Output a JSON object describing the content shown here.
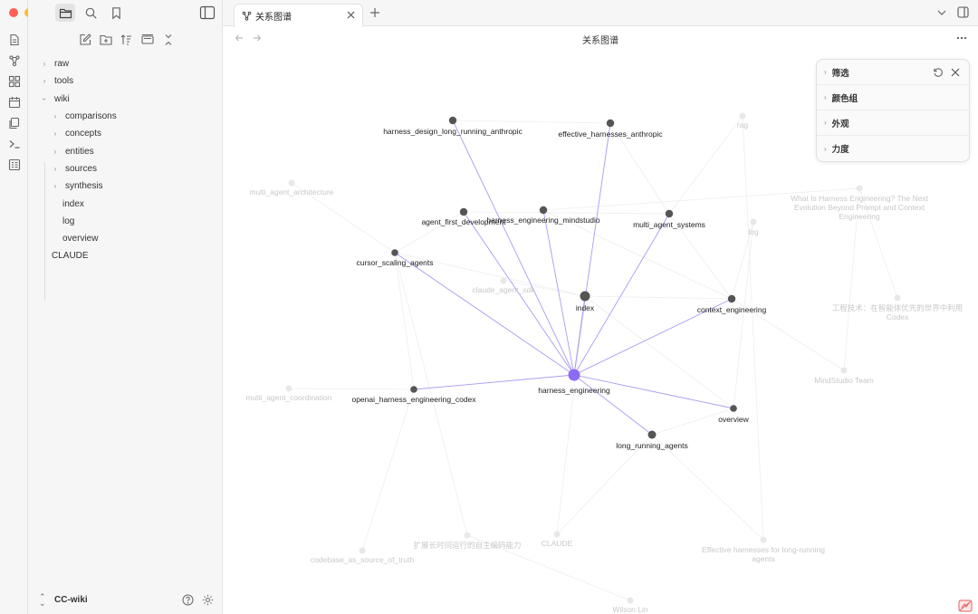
{
  "colors": {
    "sidebar_bg": "#f6f6f6",
    "accent_node": "#8b6cf0",
    "node": "#555555",
    "edge_highlight": "#a89cf0",
    "edge_faded": "#eeeeee",
    "traffic_red": "#ff5f57",
    "traffic_yellow": "#febc2e",
    "traffic_green": "#28c840"
  },
  "sidebar": {
    "tree": [
      {
        "label": "raw",
        "type": "folder",
        "level": 0,
        "expanded": false
      },
      {
        "label": "tools",
        "type": "folder",
        "level": 0,
        "expanded": false
      },
      {
        "label": "wiki",
        "type": "folder",
        "level": 0,
        "expanded": true
      },
      {
        "label": "comparisons",
        "type": "folder",
        "level": 1,
        "expanded": false
      },
      {
        "label": "concepts",
        "type": "folder",
        "level": 1,
        "expanded": false
      },
      {
        "label": "entities",
        "type": "folder",
        "level": 1,
        "expanded": false
      },
      {
        "label": "sources",
        "type": "folder",
        "level": 1,
        "expanded": false
      },
      {
        "label": "synthesis",
        "type": "folder",
        "level": 1,
        "expanded": false
      },
      {
        "label": "index",
        "type": "file",
        "level": 1
      },
      {
        "label": "log",
        "type": "file",
        "level": 1
      },
      {
        "label": "overview",
        "type": "file",
        "level": 1
      },
      {
        "label": "CLAUDE",
        "type": "file",
        "level": 0
      }
    ],
    "vault_name": "CC-wiki"
  },
  "tabs": [
    {
      "label": "关系图谱",
      "active": true
    }
  ],
  "view": {
    "title": "关系图谱"
  },
  "graph_panel": {
    "sections": [
      "筛选",
      "颜色组",
      "外观",
      "力度"
    ]
  },
  "graph": {
    "center": "harness_engineering",
    "nodes": [
      {
        "id": "harness_engineering",
        "label": "harness_engineering",
        "state": "active"
      },
      {
        "id": "harness_design_long_running_anthropic",
        "label": "harness_design_long_running_anthropic",
        "state": "linked"
      },
      {
        "id": "effective_harnesses_anthropic",
        "label": "effective_harnesses_anthropic",
        "state": "linked"
      },
      {
        "id": "agent_first_development",
        "label": "agent_first_development",
        "state": "linked"
      },
      {
        "id": "harness_engineering_mindstudio",
        "label": "harness_engineering_mindstudio",
        "state": "linked"
      },
      {
        "id": "multi_agent_systems",
        "label": "multi_agent_systems",
        "state": "linked"
      },
      {
        "id": "cursor_scaling_agents",
        "label": "cursor_scaling_agents",
        "state": "linked"
      },
      {
        "id": "index",
        "label": "index",
        "state": "linked"
      },
      {
        "id": "context_engineering",
        "label": "context_engineering",
        "state": "linked"
      },
      {
        "id": "openai_harness_engineering_codex",
        "label": "openai_harness_engineering_codex",
        "state": "linked"
      },
      {
        "id": "overview",
        "label": "overview",
        "state": "linked"
      },
      {
        "id": "long_running_agents",
        "label": "long_running_agents",
        "state": "linked"
      },
      {
        "id": "rag",
        "label": "rag",
        "state": "faded"
      },
      {
        "id": "multi_agent_architecture",
        "label": "multi_agent_architecture",
        "state": "faded"
      },
      {
        "id": "what_is_harness",
        "label": "What Is Harness Engineering? The Next\nEvolution Beyond Prompt and Context\nEngineering",
        "state": "faded"
      },
      {
        "id": "log",
        "label": "log",
        "state": "faded"
      },
      {
        "id": "claude_agent_sdk",
        "label": "claude_agent_sdk",
        "state": "faded"
      },
      {
        "id": "gongcheng",
        "label": "工程技术：在智能体优先的世界中利用\nCodex",
        "state": "faded"
      },
      {
        "id": "mindstudio_team",
        "label": "MindStudio Team",
        "state": "faded"
      },
      {
        "id": "multi_agent_coordination",
        "label": "multi_agent_coordination",
        "state": "faded"
      },
      {
        "id": "kuozhan",
        "label": "扩展长时间运行的自主编码能力",
        "state": "faded"
      },
      {
        "id": "claude",
        "label": "CLAUDE",
        "state": "faded"
      },
      {
        "id": "effective_harnesses_long",
        "label": "Effective harnesses for long-running\nagents",
        "state": "faded"
      },
      {
        "id": "codebase_as_source",
        "label": "codebase_as_source_of_truth",
        "state": "faded"
      },
      {
        "id": "wilson_lin",
        "label": "Wilson Lin",
        "state": "faded"
      }
    ]
  }
}
